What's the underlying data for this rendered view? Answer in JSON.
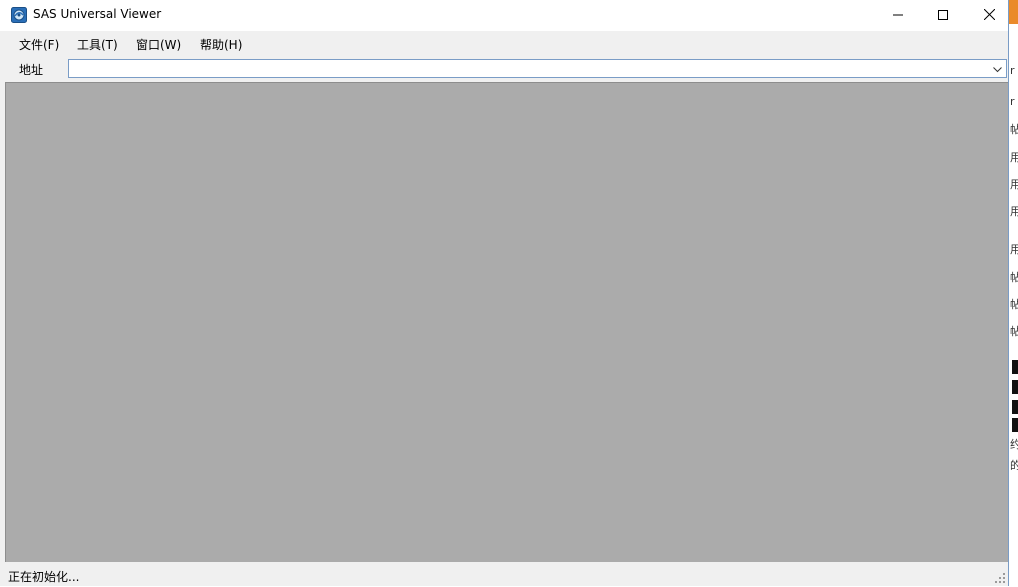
{
  "window": {
    "title": "SAS Universal Viewer"
  },
  "titlebar_buttons": {
    "minimize": "minimize-icon",
    "maximize": "maximize-icon",
    "close": "close-icon"
  },
  "menu": {
    "items": [
      {
        "label": "文件(F)"
      },
      {
        "label": "工具(T)"
      },
      {
        "label": "窗口(W)"
      },
      {
        "label": "帮助(H)"
      }
    ]
  },
  "address": {
    "label": "地址",
    "value": ""
  },
  "status": {
    "text": "正在初始化..."
  },
  "background_window": {
    "glyphs": [
      "r",
      "r",
      "帖",
      "用",
      "用",
      "用",
      "用",
      "帖",
      "帖",
      "帖",
      "约",
      "的"
    ]
  },
  "colors": {
    "accent_orange": "#ea8a2b",
    "client_gray": "#ababab",
    "chrome": "#f0f0f0",
    "border_blue": "#7a9cc6"
  }
}
